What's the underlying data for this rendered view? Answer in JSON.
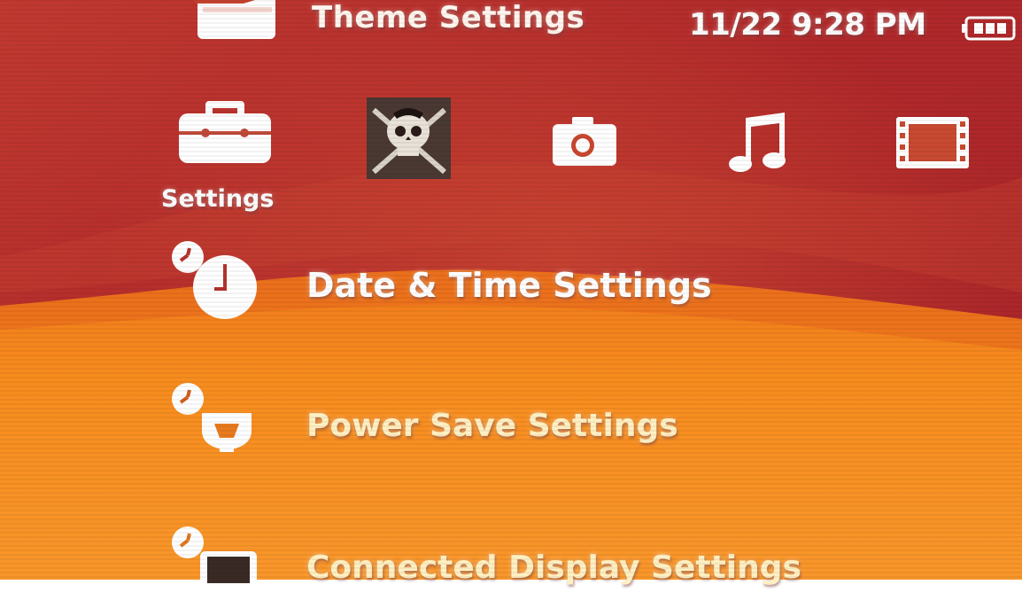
{
  "header": {
    "title": "Theme Settings",
    "clock": "11/22 9:28 PM",
    "battery_icon": "battery-icon"
  },
  "categories": [
    {
      "name": "settings",
      "icon": "toolbox-icon",
      "label": "Settings",
      "selected": true
    },
    {
      "name": "game",
      "icon": "skull-crossbones-icon"
    },
    {
      "name": "photo",
      "icon": "camera-icon"
    },
    {
      "name": "music",
      "icon": "music-note-icon"
    },
    {
      "name": "video",
      "icon": "film-strip-icon"
    }
  ],
  "menu": {
    "items": [
      {
        "label": "Date & Time Settings",
        "icon": "clock-icon",
        "selected": true
      },
      {
        "label": "Power Save Settings",
        "icon": "power-save-icon"
      },
      {
        "label": "Connected Display Settings",
        "icon": "display-icon"
      }
    ]
  },
  "colors": {
    "background_top": "#b8302a",
    "background_bottom": "#f58a1c",
    "selected_text": "#ffffff",
    "item_text": "#fff0c2"
  }
}
